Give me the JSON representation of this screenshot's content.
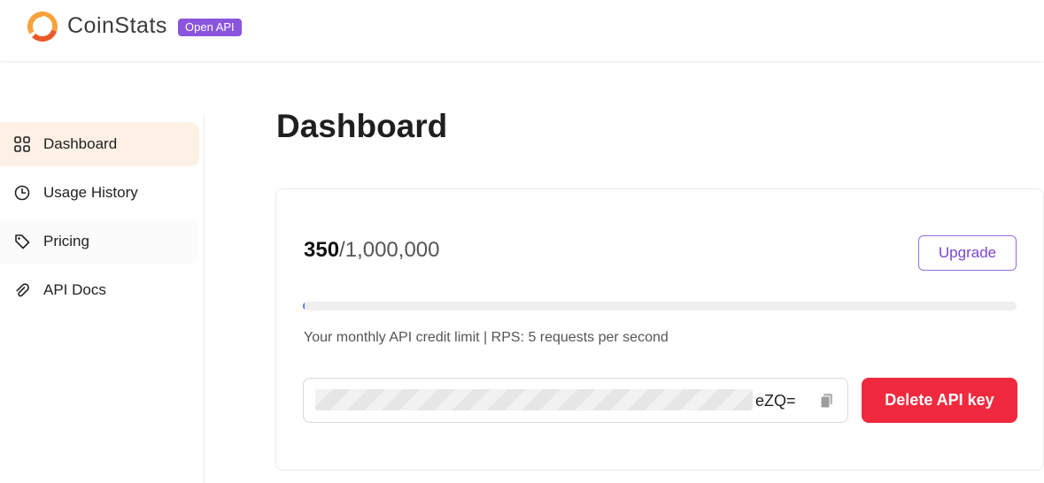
{
  "header": {
    "logo_icon": "coinstats-logo-icon",
    "brand": "CoinStats",
    "badge": "Open API",
    "badge_color": "#8a55dc"
  },
  "sidebar": {
    "items": [
      {
        "label": "Dashboard",
        "icon": "grid-icon",
        "active": true
      },
      {
        "label": "Usage History",
        "icon": "clock-icon",
        "active": false
      },
      {
        "label": "Pricing",
        "icon": "tag-icon",
        "active": false
      },
      {
        "label": "API Docs",
        "icon": "paperclip-icon",
        "active": false
      }
    ],
    "active_bg": "#fdf0e4"
  },
  "main": {
    "title": "Dashboard",
    "usage": {
      "used": "350",
      "limit": "/1,000,000",
      "progress_fraction": 0.00035
    },
    "upgrade_label": "Upgrade",
    "limit_text": "Your monthly API credit limit | RPS: 5 requests per second",
    "api_key_visible_suffix": "eZQ=",
    "copy_icon": "copy-icon",
    "delete_label": "Delete API key",
    "delete_color": "#f0293e",
    "accent_color": "#7b45cf"
  }
}
